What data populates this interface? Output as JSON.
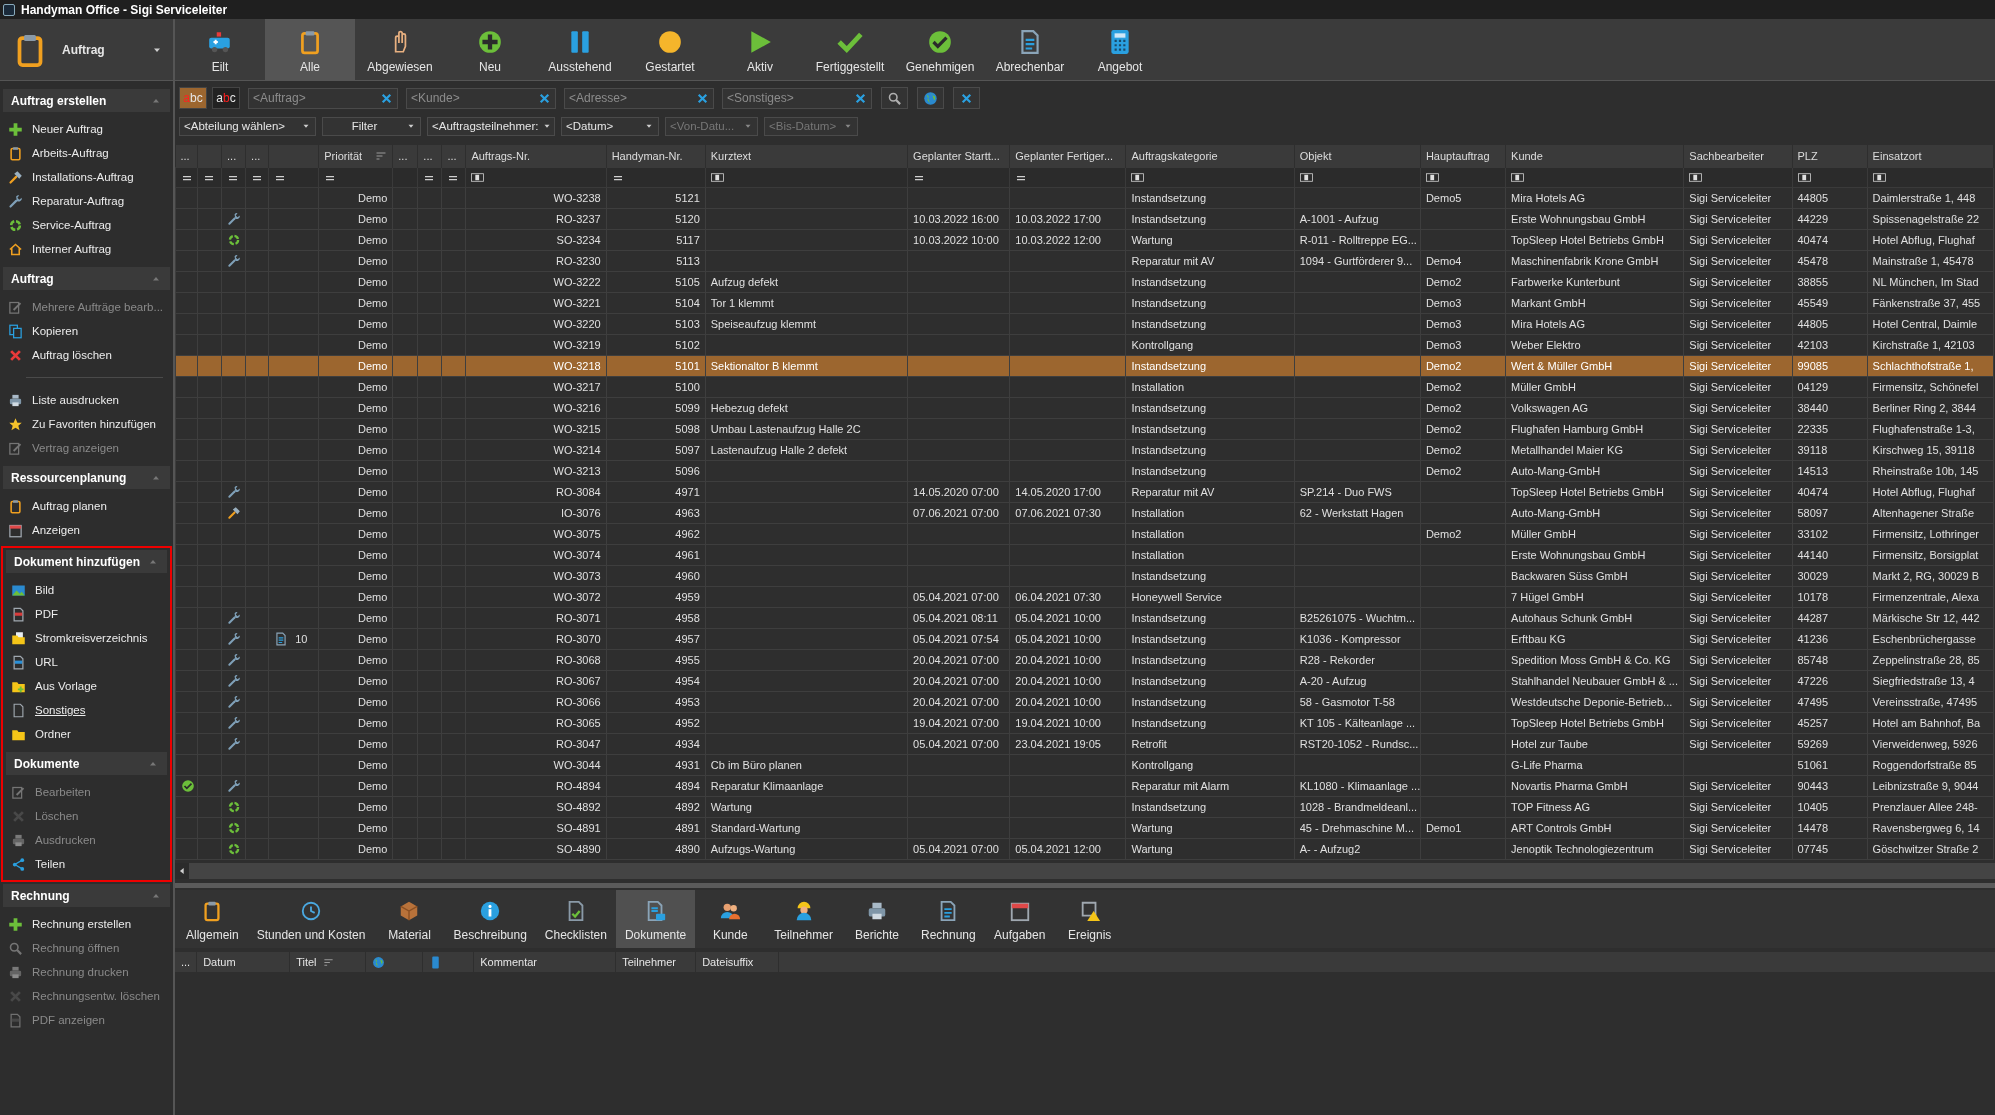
{
  "window": {
    "title": "Handyman Office - Sigi Serviceleiter"
  },
  "module": {
    "label": "Auftrag"
  },
  "toolbar": {
    "buttons": [
      {
        "label": "Eilt",
        "selected": false
      },
      {
        "label": "Alle",
        "selected": true
      },
      {
        "label": "Abgewiesen",
        "selected": false
      },
      {
        "label": "Neu",
        "selected": false
      },
      {
        "label": "Ausstehend",
        "selected": false
      },
      {
        "label": "Gestartet",
        "selected": false
      },
      {
        "label": "Aktiv",
        "selected": false
      },
      {
        "label": "Fertiggestellt",
        "selected": false
      },
      {
        "label": "Genehmigen",
        "selected": false
      },
      {
        "label": "Abrechenbar",
        "selected": false
      },
      {
        "label": "Angebot",
        "selected": false
      }
    ]
  },
  "text_toggles": [
    {
      "label": "abc",
      "selected": true
    },
    {
      "label": "abc",
      "selected": false
    }
  ],
  "search_fields": [
    {
      "placeholder": "<Auftrag>"
    },
    {
      "placeholder": "<Kunde>"
    },
    {
      "placeholder": "<Adresse>"
    },
    {
      "placeholder": "<Sonstiges>"
    }
  ],
  "dropdowns": [
    {
      "value": "<Abteilung wählen>",
      "disabled": false
    },
    {
      "value": "Filter",
      "disabled": false
    },
    {
      "value": "<Auftragsteilnehmer:",
      "disabled": false
    },
    {
      "value": "<Datum>",
      "disabled": false
    },
    {
      "value": "<Von-Datu...",
      "disabled": true
    },
    {
      "value": "<Bis-Datum>",
      "disabled": true
    }
  ],
  "sidebar": {
    "sections": [
      {
        "title": "Auftrag erstellen",
        "expanded": true,
        "highlighted": false,
        "groups": [
          [
            {
              "label": "Neuer Auftrag",
              "disabled": false,
              "hovered": false
            },
            {
              "label": "Arbeits-Auftrag",
              "disabled": false,
              "hovered": false
            },
            {
              "label": "Installations-Auftrag",
              "disabled": false,
              "hovered": false
            },
            {
              "label": "Reparatur-Auftrag",
              "disabled": false,
              "hovered": false
            },
            {
              "label": "Service-Auftrag",
              "disabled": false,
              "hovered": false
            },
            {
              "label": "Interner Auftrag",
              "disabled": false,
              "hovered": false
            }
          ]
        ]
      },
      {
        "title": "Auftrag",
        "expanded": true,
        "highlighted": false,
        "groups": [
          [
            {
              "label": "Mehrere Aufträge bearb...",
              "disabled": true,
              "hovered": false
            },
            {
              "label": "Kopieren",
              "disabled": false,
              "hovered": false
            },
            {
              "label": "Auftrag löschen",
              "disabled": false,
              "hovered": false
            }
          ],
          [
            {
              "label": "Liste ausdrucken",
              "disabled": false,
              "hovered": false
            },
            {
              "label": "Zu Favoriten hinzufügen",
              "disabled": false,
              "hovered": false
            },
            {
              "label": "Vertrag anzeigen",
              "disabled": true,
              "hovered": false
            }
          ]
        ]
      },
      {
        "title": "Ressourcenplanung",
        "expanded": true,
        "highlighted": false,
        "groups": [
          [
            {
              "label": "Auftrag planen",
              "disabled": false,
              "hovered": false
            },
            {
              "label": "Anzeigen",
              "disabled": false,
              "hovered": false
            }
          ]
        ]
      },
      {
        "title": "Dokument hinzufügen",
        "expanded": true,
        "highlighted": true,
        "groups": [
          [
            {
              "label": "Bild",
              "disabled": false,
              "hovered": false
            },
            {
              "label": "PDF",
              "disabled": false,
              "hovered": false
            },
            {
              "label": "Stromkreisverzeichnis",
              "disabled": false,
              "hovered": false
            },
            {
              "label": "URL",
              "disabled": false,
              "hovered": false
            },
            {
              "label": "Aus Vorlage",
              "disabled": false,
              "hovered": false
            },
            {
              "label": "Sonstiges",
              "disabled": false,
              "hovered": true
            },
            {
              "label": "Ordner",
              "disabled": false,
              "hovered": false
            }
          ]
        ]
      },
      {
        "title": "Dokumente",
        "expanded": true,
        "highlighted": true,
        "groups": [
          [
            {
              "label": "Bearbeiten",
              "disabled": true,
              "hovered": false
            },
            {
              "label": "Löschen",
              "disabled": true,
              "hovered": false
            },
            {
              "label": "Ausdrucken",
              "disabled": true,
              "hovered": false
            },
            {
              "label": "Teilen",
              "disabled": false,
              "hovered": false
            }
          ]
        ]
      },
      {
        "title": "Rechnung",
        "expanded": true,
        "highlighted": false,
        "groups": [
          [
            {
              "label": "Rechnung erstellen",
              "disabled": false,
              "hovered": false
            },
            {
              "label": "Rechnung öffnen",
              "disabled": true,
              "hovered": false
            },
            {
              "label": "Rechnung drucken",
              "disabled": true,
              "hovered": false
            },
            {
              "label": "Rechnungsentw. löschen",
              "disabled": true,
              "hovered": false
            },
            {
              "label": "PDF anzeigen",
              "disabled": true,
              "hovered": false
            }
          ]
        ]
      }
    ]
  },
  "table": {
    "columns": [
      {
        "label": "...",
        "filter": {
          "kind": "equals"
        },
        "sorted": false
      },
      {
        "filter": {
          "kind": "equals"
        },
        "sorted": false
      },
      {
        "label": "...",
        "filter": {
          "kind": "equals"
        },
        "sorted": false
      },
      {
        "label": "...",
        "filter": {
          "kind": "equals"
        },
        "sorted": false
      },
      {
        "filter": {
          "kind": "equals"
        },
        "sorted": false
      },
      {
        "label": "Priorität",
        "filter": {
          "kind": "equals"
        },
        "sorted": true
      },
      {
        "label": "...",
        "sorted": false
      },
      {
        "label": "...",
        "filter": {
          "kind": "equals"
        },
        "sorted": false
      },
      {
        "label": "...",
        "filter": {
          "kind": "equals"
        },
        "sorted": false
      },
      {
        "label": "Auftrags-Nr.",
        "filter": {
          "kind": "text"
        },
        "sorted": false
      },
      {
        "label": "Handyman-Nr.",
        "filter": {
          "kind": "equals"
        },
        "sorted": false
      },
      {
        "label": "Kurztext",
        "filter": {
          "kind": "text"
        },
        "sorted": false
      },
      {
        "label": "Geplanter Startt...",
        "filter": {
          "kind": "equals"
        },
        "sorted": false
      },
      {
        "label": "Geplanter Fertiger...",
        "filter": {
          "kind": "equals"
        },
        "sorted": false
      },
      {
        "label": "Auftragskategorie",
        "filter": {
          "kind": "text"
        },
        "sorted": false
      },
      {
        "label": "Objekt",
        "filter": {
          "kind": "text"
        },
        "sorted": false
      },
      {
        "label": "Hauptauftrag",
        "filter": {
          "kind": "text"
        },
        "sorted": false
      },
      {
        "label": "Kunde",
        "filter": {
          "kind": "text"
        },
        "sorted": false
      },
      {
        "label": "Sachbearbeiter",
        "filter": {
          "kind": "text"
        },
        "sorted": false
      },
      {
        "label": "PLZ",
        "filter": {
          "kind": "text"
        },
        "sorted": false
      },
      {
        "label": "Einsatzort",
        "filter": {
          "kind": "text"
        },
        "sorted": false
      }
    ],
    "rows": [
      {
        "selected": false,
        "approved": false,
        "kind": "work",
        "priority": "Demo",
        "order_no": "WO-3238",
        "handyman_no": "5121",
        "category": "Instandsetzung",
        "main_order": "Demo5",
        "customer": "Mira Hotels AG",
        "clerk": "Sigi Serviceleiter",
        "zip": "44805",
        "site": "Daimlerstraße 1, 448"
      },
      {
        "selected": false,
        "approved": false,
        "kind": "repair",
        "priority": "Demo",
        "order_no": "RO-3237",
        "handyman_no": "5120",
        "start": "10.03.2022 16:00",
        "end": "10.03.2022 17:00",
        "category": "Instandsetzung",
        "object": "A-1001 - Aufzug",
        "customer": "Erste Wohnungsbau GmbH",
        "clerk": "Sigi Serviceleiter",
        "zip": "44229",
        "site": "Spissenagelstraße 22"
      },
      {
        "selected": false,
        "approved": false,
        "kind": "service",
        "priority": "Demo",
        "order_no": "SO-3234",
        "handyman_no": "5117",
        "start": "10.03.2022 10:00",
        "end": "10.03.2022 12:00",
        "category": "Wartung",
        "object": "R-011 - Rolltreppe EG...",
        "customer": "TopSleep Hotel Betriebs GmbH",
        "clerk": "Sigi Serviceleiter",
        "zip": "40474",
        "site": "Hotel Abflug, Flughaf"
      },
      {
        "selected": false,
        "approved": false,
        "kind": "repair",
        "priority": "Demo",
        "order_no": "RO-3230",
        "handyman_no": "5113",
        "category": "Reparatur mit AV",
        "object": "1094 - Gurtförderer 9...",
        "main_order": "Demo4",
        "customer": "Maschinenfabrik Krone GmbH",
        "clerk": "Sigi Serviceleiter",
        "zip": "45478",
        "site": "Mainstraße 1, 45478"
      },
      {
        "selected": false,
        "approved": false,
        "kind": "work",
        "priority": "Demo",
        "order_no": "WO-3222",
        "handyman_no": "5105",
        "short_text": "Aufzug defekt",
        "category": "Instandsetzung",
        "main_order": "Demo2",
        "customer": "Farbwerke Kunterbunt",
        "clerk": "Sigi Serviceleiter",
        "zip": "38855",
        "site": "NL München, Im Stad"
      },
      {
        "selected": false,
        "approved": false,
        "kind": "work",
        "priority": "Demo",
        "order_no": "WO-3221",
        "handyman_no": "5104",
        "short_text": "Tor 1 klemmt",
        "category": "Instandsetzung",
        "main_order": "Demo3",
        "customer": "Markant GmbH",
        "clerk": "Sigi Serviceleiter",
        "zip": "45549",
        "site": "Fänkenstraße 37, 455"
      },
      {
        "selected": false,
        "approved": false,
        "kind": "work",
        "priority": "Demo",
        "order_no": "WO-3220",
        "handyman_no": "5103",
        "short_text": "Speiseaufzug klemmt",
        "category": "Instandsetzung",
        "main_order": "Demo3",
        "customer": "Mira Hotels AG",
        "clerk": "Sigi Serviceleiter",
        "zip": "44805",
        "site": "Hotel Central, Daimle"
      },
      {
        "selected": false,
        "approved": false,
        "kind": "work",
        "priority": "Demo",
        "order_no": "WO-3219",
        "handyman_no": "5102",
        "category": "Kontrollgang",
        "main_order": "Demo3",
        "customer": "Weber Elektro",
        "clerk": "Sigi Serviceleiter",
        "zip": "42103",
        "site": "Kirchstraße 1, 42103"
      },
      {
        "selected": true,
        "approved": false,
        "kind": "work",
        "priority": "Demo",
        "order_no": "WO-3218",
        "handyman_no": "5101",
        "short_text": "Sektionaltor B klemmt",
        "category": "Instandsetzung",
        "main_order": "Demo2",
        "customer": "Wert & Müller GmbH",
        "clerk": "Sigi Serviceleiter",
        "zip": "99085",
        "site": "Schlachthofstraße 1,"
      },
      {
        "selected": false,
        "approved": false,
        "kind": "work",
        "priority": "Demo",
        "order_no": "WO-3217",
        "handyman_no": "5100",
        "category": "Installation",
        "main_order": "Demo2",
        "customer": "Müller GmbH",
        "clerk": "Sigi Serviceleiter",
        "zip": "04129",
        "site": "Firmensitz, Schönefel"
      },
      {
        "selected": false,
        "approved": false,
        "kind": "work",
        "priority": "Demo",
        "order_no": "WO-3216",
        "handyman_no": "5099",
        "short_text": "Hebezug defekt",
        "category": "Instandsetzung",
        "main_order": "Demo2",
        "customer": "Volkswagen AG",
        "clerk": "Sigi Serviceleiter",
        "zip": "38440",
        "site": "Berliner Ring 2, 3844"
      },
      {
        "selected": false,
        "approved": false,
        "kind": "work",
        "priority": "Demo",
        "order_no": "WO-3215",
        "handyman_no": "5098",
        "short_text": "Umbau Lastenaufzug Halle 2C",
        "category": "Instandsetzung",
        "main_order": "Demo2",
        "customer": "Flughafen Hamburg GmbH",
        "clerk": "Sigi Serviceleiter",
        "zip": "22335",
        "site": "Flughafenstraße 1-3,"
      },
      {
        "selected": false,
        "approved": false,
        "kind": "work",
        "priority": "Demo",
        "order_no": "WO-3214",
        "handyman_no": "5097",
        "short_text": "Lastenaufzug Halle 2 defekt",
        "category": "Instandsetzung",
        "main_order": "Demo2",
        "customer": "Metallhandel Maier KG",
        "clerk": "Sigi Serviceleiter",
        "zip": "39118",
        "site": "Kirschweg 15, 39118"
      },
      {
        "selected": false,
        "approved": false,
        "kind": "work",
        "priority": "Demo",
        "order_no": "WO-3213",
        "handyman_no": "5096",
        "category": "Instandsetzung",
        "main_order": "Demo2",
        "customer": "Auto-Mang-GmbH",
        "clerk": "Sigi Serviceleiter",
        "zip": "14513",
        "site": "Rheinstraße 10b, 145"
      },
      {
        "selected": false,
        "approved": false,
        "kind": "repair",
        "priority": "Demo",
        "order_no": "RO-3084",
        "handyman_no": "4971",
        "start": "14.05.2020 07:00",
        "end": "14.05.2020 17:00",
        "category": "Reparatur mit AV",
        "object": "SP.214 - Duo FWS",
        "customer": "TopSleep Hotel Betriebs GmbH",
        "clerk": "Sigi Serviceleiter",
        "zip": "40474",
        "site": "Hotel Abflug, Flughaf"
      },
      {
        "selected": false,
        "approved": false,
        "kind": "installation",
        "priority": "Demo",
        "order_no": "IO-3076",
        "handyman_no": "4963",
        "start": "07.06.2021 07:00",
        "end": "07.06.2021 07:30",
        "category": "Installation",
        "object": "62 - Werkstatt Hagen",
        "customer": "Auto-Mang-GmbH",
        "clerk": "Sigi Serviceleiter",
        "zip": "58097",
        "site": "Altenhagener Straße"
      },
      {
        "selected": false,
        "approved": false,
        "kind": "work",
        "priority": "Demo",
        "order_no": "WO-3075",
        "handyman_no": "4962",
        "category": "Installation",
        "main_order": "Demo2",
        "customer": "Müller GmbH",
        "clerk": "Sigi Serviceleiter",
        "zip": "33102",
        "site": "Firmensitz, Lothringer"
      },
      {
        "selected": false,
        "approved": false,
        "kind": "work",
        "priority": "Demo",
        "order_no": "WO-3074",
        "handyman_no": "4961",
        "category": "Installation",
        "customer": "Erste Wohnungsbau GmbH",
        "clerk": "Sigi Serviceleiter",
        "zip": "44140",
        "site": "Firmensitz, Borsigplat"
      },
      {
        "selected": false,
        "approved": false,
        "kind": "work",
        "priority": "Demo",
        "order_no": "WO-3073",
        "handyman_no": "4960",
        "category": "Instandsetzung",
        "customer": "Backwaren Süss GmbH",
        "clerk": "Sigi Serviceleiter",
        "zip": "30029",
        "site": "Markt 2, RG, 30029 B"
      },
      {
        "selected": false,
        "approved": false,
        "kind": "work",
        "priority": "Demo",
        "order_no": "WO-3072",
        "handyman_no": "4959",
        "start": "05.04.2021 07:00",
        "end": "06.04.2021 07:30",
        "category": "Honeywell Service",
        "customer": "7 Hügel GmbH",
        "clerk": "Sigi Serviceleiter",
        "zip": "10178",
        "site": "Firmenzentrale, Alexa"
      },
      {
        "selected": false,
        "approved": false,
        "kind": "repair",
        "priority": "Demo",
        "order_no": "RO-3071",
        "handyman_no": "4958",
        "start": "05.04.2021 08:11",
        "end": "05.04.2021 10:00",
        "category": "Instandsetzung",
        "object": "B25261075 - Wuchtm...",
        "customer": "Autohaus Schunk GmbH",
        "clerk": "Sigi Serviceleiter",
        "zip": "44287",
        "site": "Märkische Str 12, 442"
      },
      {
        "selected": false,
        "approved": false,
        "kind": "repair",
        "documents": "10",
        "priority": "Demo",
        "order_no": "RO-3070",
        "handyman_no": "4957",
        "start": "05.04.2021 07:54",
        "end": "05.04.2021 10:00",
        "category": "Instandsetzung",
        "object": "K1036 - Kompressor",
        "customer": "Erftbau KG",
        "clerk": "Sigi Serviceleiter",
        "zip": "41236",
        "site": "Eschenbrüchergasse"
      },
      {
        "selected": false,
        "approved": false,
        "kind": "repair",
        "priority": "Demo",
        "order_no": "RO-3068",
        "handyman_no": "4955",
        "start": "20.04.2021 07:00",
        "end": "20.04.2021 10:00",
        "category": "Instandsetzung",
        "object": "R28 - Rekorder",
        "customer": "Spedition Moss GmbH & Co. KG",
        "clerk": "Sigi Serviceleiter",
        "zip": "85748",
        "site": "Zeppelinstraße 28, 85"
      },
      {
        "selected": false,
        "approved": false,
        "kind": "repair",
        "priority": "Demo",
        "order_no": "RO-3067",
        "handyman_no": "4954",
        "start": "20.04.2021 07:00",
        "end": "20.04.2021 10:00",
        "category": "Instandsetzung",
        "object": "A-20 - Aufzug",
        "customer": "Stahlhandel Neubauer GmbH & ...",
        "clerk": "Sigi Serviceleiter",
        "zip": "47226",
        "site": "Siegfriedstraße 13, 4"
      },
      {
        "selected": false,
        "approved": false,
        "kind": "repair",
        "priority": "Demo",
        "order_no": "RO-3066",
        "handyman_no": "4953",
        "start": "20.04.2021 07:00",
        "end": "20.04.2021 10:00",
        "category": "Instandsetzung",
        "object": "58 - Gasmotor T-58",
        "customer": "Westdeutsche Deponie-Betrieb...",
        "clerk": "Sigi Serviceleiter",
        "zip": "47495",
        "site": "Vereinsstraße, 47495"
      },
      {
        "selected": false,
        "approved": false,
        "kind": "repair",
        "priority": "Demo",
        "order_no": "RO-3065",
        "handyman_no": "4952",
        "start": "19.04.2021 07:00",
        "end": "19.04.2021 10:00",
        "category": "Instandsetzung",
        "object": "KT 105 - Kälteanlage ...",
        "customer": "TopSleep Hotel Betriebs GmbH",
        "clerk": "Sigi Serviceleiter",
        "zip": "45257",
        "site": "Hotel am Bahnhof, Ba"
      },
      {
        "selected": false,
        "approved": false,
        "kind": "repair",
        "priority": "Demo",
        "order_no": "RO-3047",
        "handyman_no": "4934",
        "start": "05.04.2021 07:00",
        "end": "23.04.2021 19:05",
        "category": "Retrofit",
        "object": "RST20-1052 - Rundsc...",
        "customer": "Hotel zur Taube",
        "clerk": "Sigi Serviceleiter",
        "zip": "59269",
        "site": "Vierweidenweg, 5926"
      },
      {
        "selected": false,
        "approved": false,
        "kind": "work",
        "priority": "Demo",
        "order_no": "WO-3044",
        "handyman_no": "4931",
        "short_text": "Cb im Büro planen",
        "category": "Kontrollgang",
        "customer": "G-Life Pharma",
        "zip": "51061",
        "site": "Roggendorfstraße 85"
      },
      {
        "selected": false,
        "approved": true,
        "kind": "repair",
        "priority": "Demo",
        "order_no": "RO-4894",
        "handyman_no": "4894",
        "short_text": "Reparatur Klimaanlage",
        "category": "Reparatur mit Alarm",
        "object": "KL1080 - Klimaanlage ...",
        "customer": "Novartis Pharma GmbH",
        "clerk": "Sigi Serviceleiter",
        "zip": "90443",
        "site": "Leibnizstraße 9, 9044"
      },
      {
        "selected": false,
        "approved": false,
        "kind": "service",
        "priority": "Demo",
        "order_no": "SO-4892",
        "handyman_no": "4892",
        "short_text": "Wartung",
        "category": "Instandsetzung",
        "object": "1028 - Brandmeldeanl...",
        "customer": "TOP Fitness AG",
        "clerk": "Sigi Serviceleiter",
        "zip": "10405",
        "site": "Prenzlauer Allee 248-"
      },
      {
        "selected": false,
        "approved": false,
        "kind": "service",
        "priority": "Demo",
        "order_no": "SO-4891",
        "handyman_no": "4891",
        "short_text": "Standard-Wartung",
        "category": "Wartung",
        "object": "45 - Drehmaschine M...",
        "main_order": "Demo1",
        "customer": "ART Controls GmbH",
        "clerk": "Sigi Serviceleiter",
        "zip": "14478",
        "site": "Ravensbergweg 6, 14"
      },
      {
        "selected": false,
        "approved": false,
        "kind": "service",
        "priority": "Demo",
        "order_no": "SO-4890",
        "handyman_no": "4890",
        "short_text": "Aufzugs-Wartung",
        "start": "05.04.2021 07:00",
        "end": "05.04.2021 12:00",
        "category": "Wartung",
        "object": "A- - Aufzug2",
        "customer": "Jenoptik Technologiezentrum",
        "clerk": "Sigi Serviceleiter",
        "zip": "07745",
        "site": "Göschwitzer Straße 2"
      }
    ]
  },
  "detail_tabs": [
    {
      "label": "Allgemein",
      "selected": false
    },
    {
      "label": "Stunden und Kosten",
      "selected": false
    },
    {
      "label": "Material",
      "selected": false
    },
    {
      "label": "Beschreibung",
      "selected": false
    },
    {
      "label": "Checklisten",
      "selected": false
    },
    {
      "label": "Dokumente",
      "selected": true
    },
    {
      "label": "Kunde",
      "selected": false
    },
    {
      "label": "Teilnehmer",
      "selected": false
    },
    {
      "label": "Berichte",
      "selected": false
    },
    {
      "label": "Rechnung",
      "selected": false
    },
    {
      "label": "Aufgaben",
      "selected": false
    },
    {
      "label": "Ereignis",
      "selected": false
    }
  ],
  "detail_columns": [
    {
      "label": "...",
      "sorted": false
    },
    {
      "label": "Datum",
      "sorted": false
    },
    {
      "label": "Titel",
      "sorted": true
    },
    {
      "kind": "globe",
      "sorted": false
    },
    {
      "kind": "phone",
      "sorted": false
    },
    {
      "label": "Kommentar",
      "sorted": false
    },
    {
      "label": "Teilnehmer",
      "sorted": false
    },
    {
      "label": "Dateisuffix",
      "sorted": false
    }
  ]
}
